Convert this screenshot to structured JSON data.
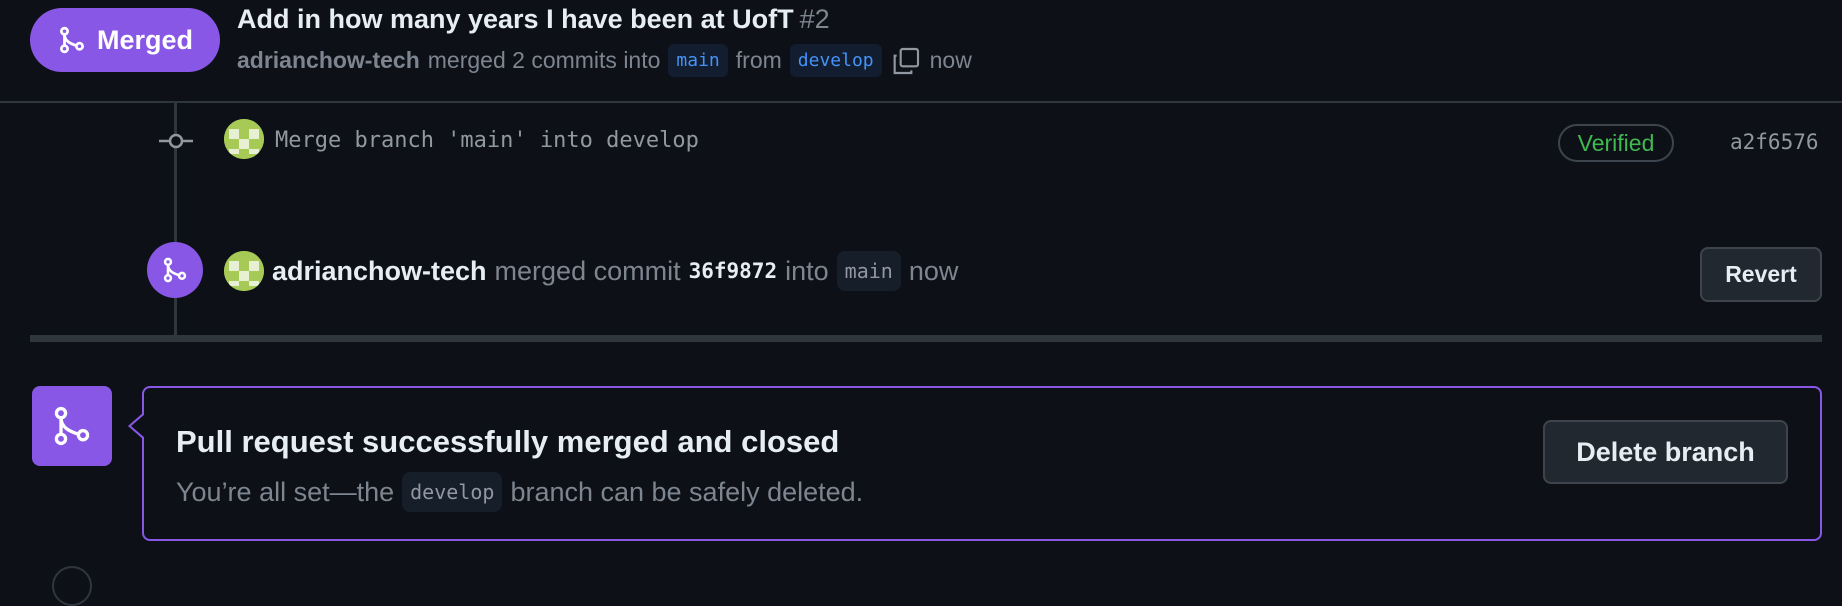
{
  "header": {
    "status_label": "Merged",
    "title": "Add in how many years I have been at UofT",
    "number": "#2",
    "meta": {
      "author": "adrianchow-tech",
      "action": "merged 2 commits into",
      "base_branch": "main",
      "from_label": "from",
      "head_branch": "develop",
      "time": "now"
    }
  },
  "timeline": {
    "commit": {
      "message": "Merge branch 'main' into develop",
      "verified_label": "Verified",
      "sha": "a2f6576"
    },
    "merge_event": {
      "author": "adrianchow-tech",
      "action": "merged commit",
      "sha": "36f9872",
      "into_label": "into",
      "branch": "main",
      "time": "now",
      "revert_label": "Revert"
    }
  },
  "merged_box": {
    "title": "Pull request successfully merged and closed",
    "desc_prefix": "You’re all set—the",
    "branch": "develop",
    "desc_suffix": "branch can be safely deleted.",
    "delete_label": "Delete branch"
  },
  "colors": {
    "background": "#0d1117",
    "merged_purple": "#8957e5",
    "verified_green": "#3fb950",
    "branch_blue": "#4493f8"
  },
  "icons": {
    "merge": "git-merge-icon",
    "copy": "copy-icon",
    "commit": "git-commit-icon"
  }
}
